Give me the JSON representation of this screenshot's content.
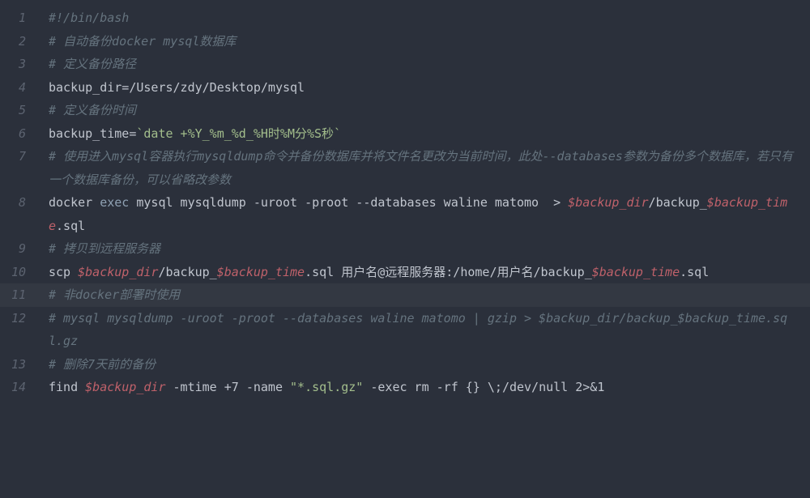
{
  "lines": {
    "n1": "1",
    "n2": "2",
    "n3": "3",
    "n4": "4",
    "n5": "5",
    "n6": "6",
    "n7": "7",
    "n8": "8",
    "n9": "9",
    "n10": "10",
    "n11": "11",
    "n12": "12",
    "n13": "13",
    "n14": "14"
  },
  "l1": {
    "shebang": "#!/bin/bash"
  },
  "l2": {
    "comment": "# 自动备份docker mysql数据库"
  },
  "l3": {
    "comment": "# 定义备份路径"
  },
  "l4": {
    "assign": "backup_dir=/Users/zdy/Desktop/mysql"
  },
  "l5": {
    "comment": "# 定义备份时间"
  },
  "l6": {
    "assign": "backup_time=",
    "bq1": "`",
    "date": "date +%Y_%m_%d_%H时%M分%S秒",
    "bq2": "`"
  },
  "l7": {
    "comment": "# 使用进入mysql容器执行mysqldump命令并备份数据库并将文件名更改为当前时间，此处--databases参数为备份多个数据库，若只有一个数据库备份，可以省略改参数"
  },
  "l8": {
    "docker": "docker ",
    "exec": "exec",
    "args": " mysql mysqldump -uroot -proot --databases waline matomo  > ",
    "v1": "$backup_dir",
    "mid": "/backup_",
    "v2": "$backup_time",
    "end": ".sql"
  },
  "l9": {
    "comment": "# 拷贝到远程服务器"
  },
  "l10": {
    "scp": "scp ",
    "v1": "$backup_dir",
    "m1": "/backup_",
    "v2": "$backup_time",
    "m2": ".sql 用户名@远程服务器:/home/用户名/backup_",
    "v3": "$backup_time",
    "end": ".sql"
  },
  "l11": {
    "comment": "# 非docker部署时使用"
  },
  "l12": {
    "comment": "# mysql mysqldump -uroot -proot --databases waline matomo | gzip > $backup_dir/backup_$backup_time.sql.gz"
  },
  "l13": {
    "comment": "# 删除7天前的备份"
  },
  "l14": {
    "find": "find ",
    "v1": "$backup_dir",
    "m1": " -mtime +7 -name ",
    "str": "\"*.sql.gz\"",
    "m2": " -exec rm -rf {} ",
    "esc": "\\;",
    "m3": "/dev/null 2>&1"
  }
}
